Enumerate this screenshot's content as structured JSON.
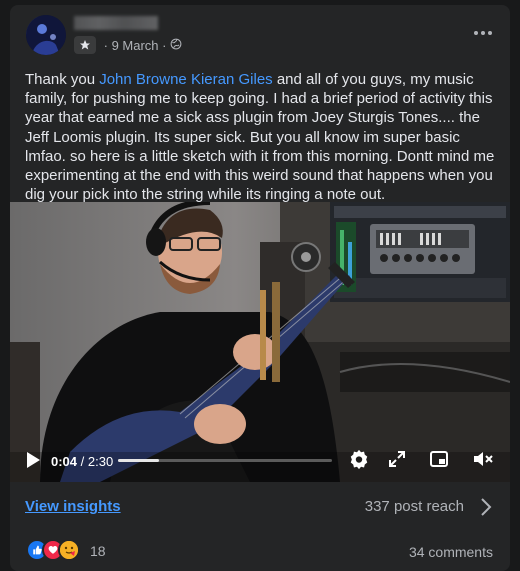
{
  "post": {
    "date": "9 March",
    "caption": {
      "before": "Thank you ",
      "mention1": "John Browne",
      "sep": " ",
      "mention2": "Kieran Giles",
      "after": " and all of you guys, my music family, for pushing me to keep going. I had a brief period of activity this year that earned me a sick ass plugin from Joey Sturgis Tones.... the Jeff Loomis plugin. Its super sick. But you all know im super basic lmfao. so here is a little sketch with it from this morning. Dontt mind me experimenting at the end with this weird sound that happens when you dig your pick into the string while its ringing a note out."
    }
  },
  "video": {
    "current_time": "0:04",
    "separator": " / ",
    "duration": "2:30",
    "progress": 0.19
  },
  "footer": {
    "insights_label": "View insights",
    "reach_label": "337 post reach",
    "reaction_count": "18",
    "comments_label": "34 comments"
  },
  "colors": {
    "accent": "#4599ff",
    "like": "#1877f2",
    "love": "#f02849",
    "care": "#f7b125"
  },
  "icons": [
    "star-icon",
    "globe-icon",
    "more-icon",
    "play-icon",
    "settings-icon",
    "fullscreen-icon",
    "pip-icon",
    "volume-muted-icon",
    "chevron-right-icon",
    "like-reaction-icon",
    "love-reaction-icon",
    "care-reaction-icon"
  ]
}
